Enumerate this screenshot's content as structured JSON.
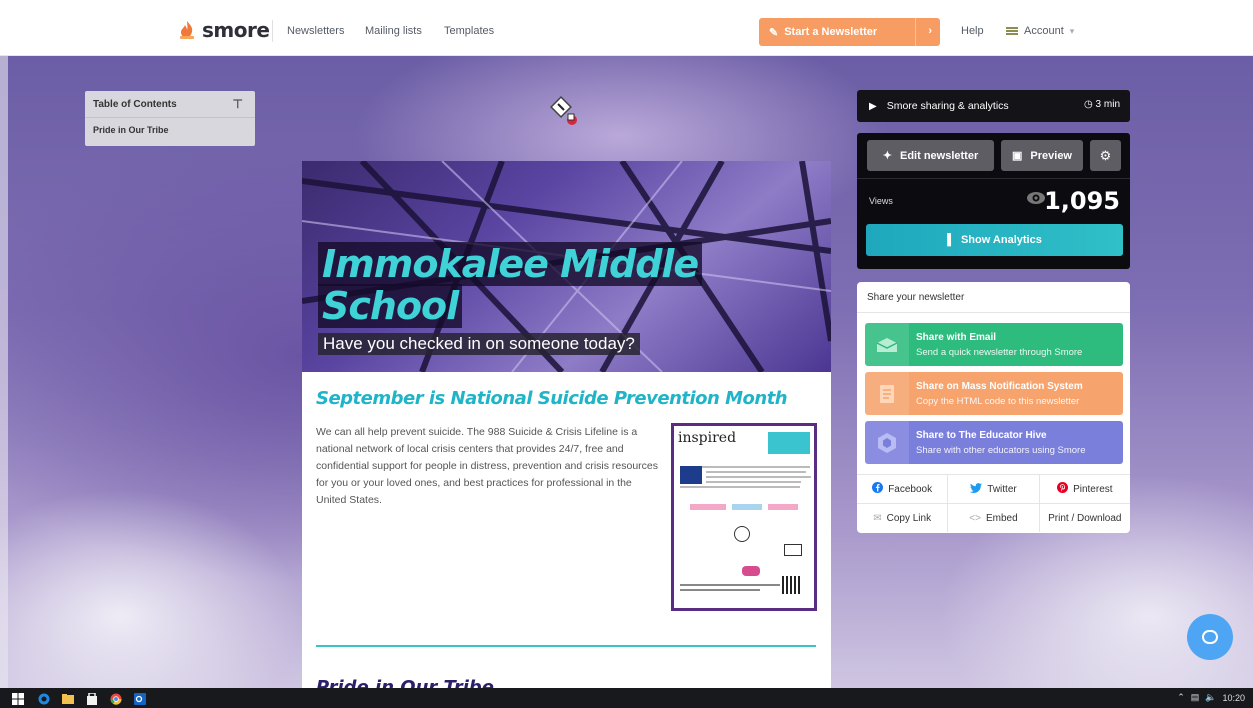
{
  "nav": {
    "logo_text": "smore",
    "links": [
      "Newsletters",
      "Mailing lists",
      "Templates"
    ],
    "start_button": "Start a Newsletter",
    "help": "Help",
    "account": "Account"
  },
  "toc": {
    "title": "Table of Contents",
    "items": [
      "Pride in Our Tribe"
    ]
  },
  "newsletter": {
    "title_line1": "Immokalee Middle",
    "title_line2": "School",
    "subtitle": "Have you checked in on someone today?",
    "section_title": "September is National Suicide Prevention Month",
    "section_text": "We can all help prevent suicide. The 988 Suicide & Crisis Lifeline is a national network of local crisis centers that provides 24/7, free and confidential support for people in distress, prevention and crisis resources for you or your loved ones, and best practices for professional in the United States.",
    "flyer_title": "inspired",
    "next_section_title": "Pride in Our Tribe"
  },
  "panel": {
    "sharing_title": "Smore sharing & analytics",
    "sharing_time": "3 min",
    "edit_button": "Edit newsletter",
    "preview_button": "Preview",
    "views_label": "Views",
    "views_count": "1,095",
    "analytics_button": "Show Analytics"
  },
  "share": {
    "heading": "Share your newsletter",
    "options": [
      {
        "title": "Share with Email",
        "subtitle": "Send a quick newsletter through Smore",
        "color": "#2ebb7e"
      },
      {
        "title": "Share on Mass Notification System",
        "subtitle": "Copy the HTML code to this newsletter",
        "color": "#f6a36d"
      },
      {
        "title": "Share to The Educator Hive",
        "subtitle": "Share with other educators using Smore",
        "color": "#7b7fdc"
      }
    ],
    "social": [
      "Facebook",
      "Twitter",
      "Pinterest"
    ],
    "actions": [
      "Copy Link",
      "Embed",
      "Print / Download"
    ]
  },
  "taskbar": {
    "time": "10:20"
  },
  "colors": {
    "accent_orange": "#f79d63",
    "teal": "#1fb4c7",
    "panel_dark": "#0c0c10"
  }
}
